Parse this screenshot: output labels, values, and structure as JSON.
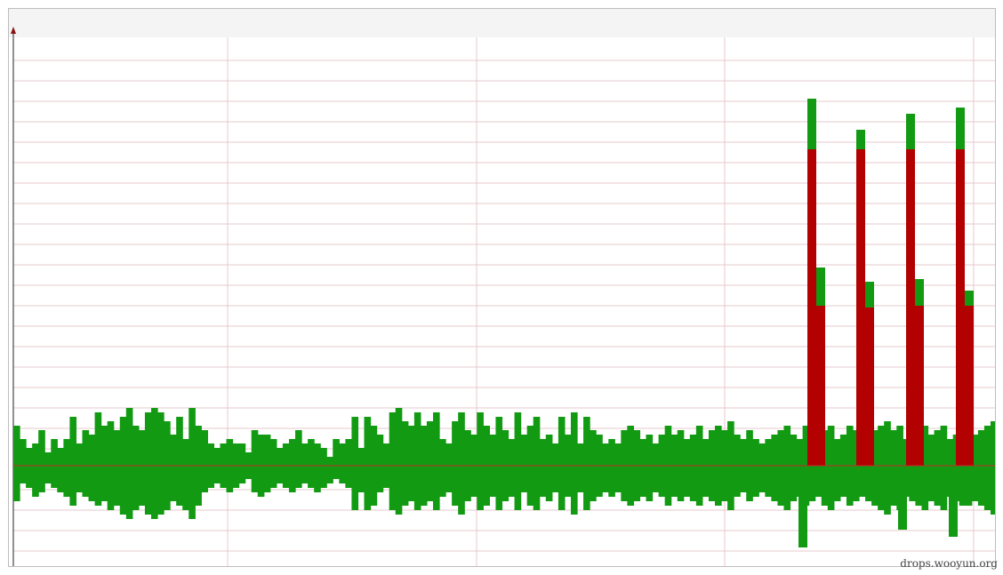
{
  "chart_data": {
    "type": "bar",
    "title": "",
    "xlabel": "",
    "ylabel": "",
    "colors": {
      "normal": "#129b12",
      "anomaly": "#b30000",
      "grid": "#e7c9cc",
      "baseline": "#c22a2a"
    },
    "ylim": [
      -100,
      400
    ],
    "grid": true,
    "note_y_units": "relative amplitude, baseline = 0",
    "series": [
      {
        "name": "",
        "color": "#129b12",
        "upper": [
          45,
          30,
          20,
          25,
          40,
          15,
          30,
          20,
          30,
          55,
          25,
          40,
          35,
          60,
          45,
          50,
          40,
          55,
          65,
          45,
          40,
          60,
          65,
          60,
          50,
          35,
          55,
          30,
          65,
          45,
          40,
          25,
          20,
          25,
          30,
          25,
          25,
          15,
          40,
          35,
          35,
          30,
          20,
          25,
          30,
          40,
          25,
          30,
          25,
          20,
          10,
          30,
          25,
          30,
          55,
          20,
          55,
          45,
          35,
          25,
          60,
          65,
          50,
          45,
          60,
          45,
          50,
          60,
          30,
          25,
          50,
          60,
          40,
          35,
          60,
          45,
          35,
          55,
          40,
          30,
          60,
          35,
          45,
          55,
          30,
          35,
          25,
          55,
          35,
          60,
          25,
          55,
          40,
          35,
          25,
          30,
          25,
          40,
          45,
          40,
          30,
          35,
          25,
          35,
          45,
          35,
          40,
          30,
          35,
          45,
          30,
          40,
          45,
          40,
          50,
          35,
          30,
          40,
          30,
          25,
          30,
          35,
          40,
          45,
          35,
          30,
          45,
          40,
          35,
          40,
          45,
          30,
          35,
          45,
          40,
          30,
          35,
          40,
          45,
          50,
          40,
          45,
          30,
          35,
          40,
          45,
          35,
          40,
          45,
          30,
          35,
          40,
          40,
          35,
          40,
          45,
          50
        ],
        "lower": [
          -40,
          -20,
          -25,
          -35,
          -30,
          -20,
          -25,
          -30,
          -35,
          -45,
          -30,
          -35,
          -40,
          -45,
          -40,
          -50,
          -45,
          -55,
          -60,
          -50,
          -45,
          -55,
          -60,
          -55,
          -50,
          -40,
          -45,
          -50,
          -60,
          -45,
          -30,
          -25,
          -20,
          -25,
          -30,
          -25,
          -20,
          -15,
          -30,
          -35,
          -30,
          -25,
          -20,
          -25,
          -30,
          -25,
          -20,
          -25,
          -30,
          -25,
          -20,
          -15,
          -20,
          -25,
          -50,
          -30,
          -50,
          -45,
          -30,
          -25,
          -50,
          -55,
          -45,
          -40,
          -50,
          -45,
          -40,
          -50,
          -35,
          -30,
          -45,
          -55,
          -40,
          -35,
          -50,
          -45,
          -35,
          -50,
          -40,
          -35,
          -50,
          -30,
          -45,
          -50,
          -35,
          -40,
          -30,
          -50,
          -35,
          -55,
          -30,
          -50,
          -40,
          -35,
          -30,
          -35,
          -30,
          -40,
          -45,
          -40,
          -35,
          -40,
          -30,
          -35,
          -45,
          -35,
          -40,
          -35,
          -40,
          -45,
          -35,
          -40,
          -45,
          -40,
          -50,
          -35,
          -30,
          -40,
          -35,
          -30,
          -35,
          -40,
          -45,
          -50,
          -40,
          -35,
          -45,
          -40,
          -35,
          -45,
          -50,
          -40,
          -35,
          -45,
          -40,
          -35,
          -40,
          -45,
          -50,
          -55,
          -45,
          -50,
          -35,
          -40,
          -45,
          -50,
          -40,
          -45,
          -50,
          -35,
          -40,
          -45,
          -45,
          -40,
          -45,
          -50,
          -55
        ]
      },
      {
        "name": "",
        "color": "#b30000",
        "spikes": [
          {
            "x": 907,
            "top": 413,
            "red_top": 356
          },
          {
            "x": 917,
            "top": 223,
            "red_top": 180
          },
          {
            "x": 962,
            "top": 378,
            "red_top": 356
          },
          {
            "x": 972,
            "top": 207,
            "red_top": 178
          },
          {
            "x": 1018,
            "top": 396,
            "red_top": 356
          },
          {
            "x": 1028,
            "top": 210,
            "red_top": 180
          },
          {
            "x": 1074,
            "top": 403,
            "red_top": 356
          },
          {
            "x": 1084,
            "top": 197,
            "red_top": 180
          }
        ]
      }
    ]
  },
  "watermark": "drops.wooyun.org"
}
